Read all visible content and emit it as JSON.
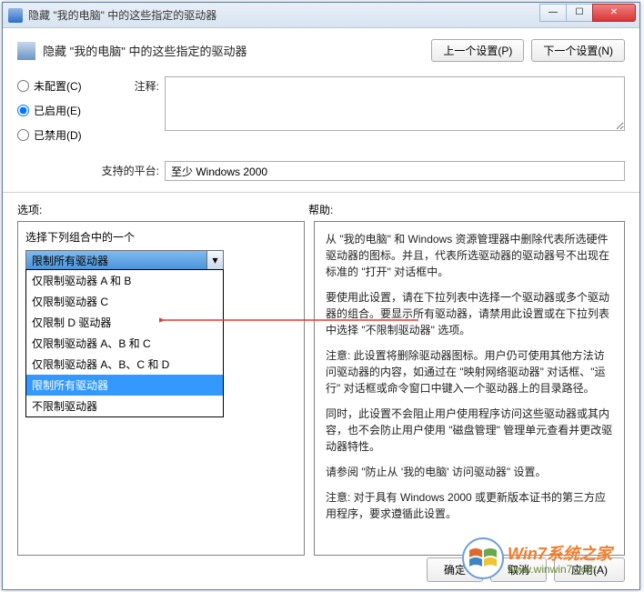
{
  "window": {
    "title": "隐藏 \"我的电脑\" 中的这些指定的驱动器"
  },
  "header": {
    "title": "隐藏 \"我的电脑\" 中的这些指定的驱动器",
    "prev_btn": "上一个设置(P)",
    "next_btn": "下一个设置(N)"
  },
  "radios": {
    "unconfigured": "未配置(C)",
    "enabled": "已启用(E)",
    "disabled": "已禁用(D)"
  },
  "labels": {
    "comment": "注释:",
    "platform": "支持的平台:",
    "platform_value": "至少 Windows 2000",
    "options": "选项:",
    "help": "帮助:"
  },
  "left": {
    "caption": "选择下列组合中的一个",
    "combo_value": "限制所有驱动器",
    "options": [
      "仅限制驱动器 A 和 B",
      "仅限制驱动器 C",
      "仅限制 D 驱动器",
      "仅限制驱动器 A、B 和 C",
      "仅限制驱动器 A、B、C 和 D",
      "限制所有驱动器",
      "不限制驱动器"
    ]
  },
  "help": {
    "p1": "从 \"我的电脑\" 和 Windows 资源管理器中删除代表所选硬件驱动器的图标。并且，代表所选驱动器的驱动器号不出现在标准的 \"打开\" 对话框中。",
    "p2": "要使用此设置，请在下拉列表中选择一个驱动器或多个驱动器的组合。要显示所有驱动器，请禁用此设置或在下拉列表中选择 \"不限制驱动器\" 选项。",
    "p3": "注意: 此设置将删除驱动器图标。用户仍可使用其他方法访问驱动器的内容，如通过在 \"映射网络驱动器\" 对话框、\"运行\" 对话框或命令窗口中键入一个驱动器上的目录路径。",
    "p4": "同时，此设置不会阻止用户使用程序访问这些驱动器或其内容，也不会防止用户使用 \"磁盘管理\" 管理单元查看并更改驱动器特性。",
    "p5": "请参阅 \"防止从 '我的电脑' 访问驱动器\" 设置。",
    "p6": "注意: 对于具有 Windows 2000 或更新版本证书的第三方应用程序，要求遵循此设置。"
  },
  "footer": {
    "ok": "确定",
    "cancel": "取消",
    "apply": "应用(A)"
  },
  "watermark": {
    "brand": "Win7系统之家",
    "url": "www.winwin7.com"
  }
}
